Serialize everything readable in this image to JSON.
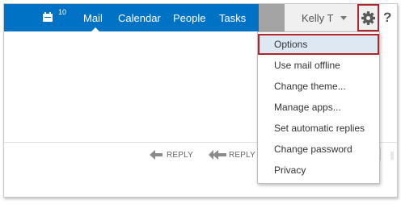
{
  "header": {
    "calendar_badge_count": "10",
    "nav": [
      {
        "label": "Mail",
        "active": true
      },
      {
        "label": "Calendar",
        "active": false
      },
      {
        "label": "People",
        "active": false
      },
      {
        "label": "Tasks",
        "active": false
      }
    ],
    "user_name": "Kelly T",
    "help_label": "?"
  },
  "reading_pane": {
    "reply_label": "REPLY",
    "reply_all_label": "REPLY A"
  },
  "settings_menu": {
    "items": [
      {
        "label": "Options",
        "selected": true
      },
      {
        "label": "Use mail offline",
        "selected": false
      },
      {
        "label": "Change theme...",
        "selected": false
      },
      {
        "label": "Manage apps...",
        "selected": false
      },
      {
        "label": "Set automatic replies",
        "selected": false
      },
      {
        "label": "Change password",
        "selected": false
      },
      {
        "label": "Privacy",
        "selected": false
      }
    ]
  },
  "colors": {
    "brand_blue": "#0072c6",
    "highlight_red": "#b1262b",
    "menu_selected_bg": "#dde8f3"
  },
  "icons": [
    "calendar-icon",
    "chevron-down-icon",
    "gear-icon",
    "help-icon",
    "reply-arrow-icon",
    "reply-all-arrow-icon"
  ]
}
